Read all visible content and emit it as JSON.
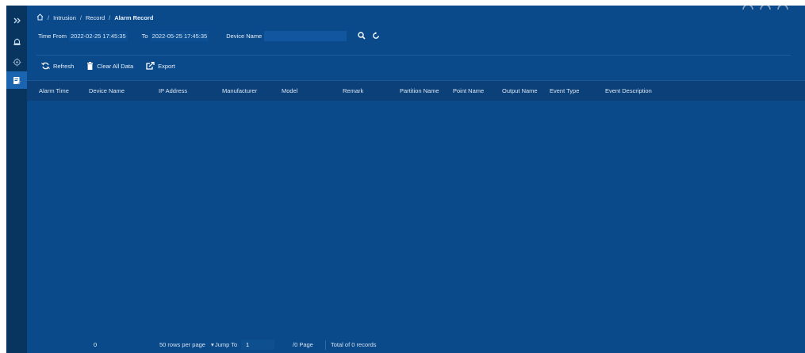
{
  "colors": {
    "background": "#0a4a8a",
    "sidebar": "#08355f",
    "sidebar_active": "#1b64b0",
    "table_header": "#0b4078",
    "text": "#ffffff"
  },
  "sidebar": {
    "items": [
      {
        "name": "expand",
        "icon": "double-chevron-right-icon",
        "active": false
      },
      {
        "name": "intrusion",
        "icon": "alarm-bell-icon",
        "active": false
      },
      {
        "name": "settings",
        "icon": "gear-icon",
        "active": false
      },
      {
        "name": "record",
        "icon": "record-edit-icon",
        "active": true
      }
    ]
  },
  "breadcrumb": {
    "home_icon": "home-icon",
    "separator": "/",
    "items": [
      "Intrusion",
      "Record",
      "Alarm Record"
    ]
  },
  "filter": {
    "time_from_label": "Time From",
    "time_from_value": "2022-02-25 17:45:35",
    "to_label": "To",
    "to_value": "2022-05-25 17:45:35",
    "device_name_label": "Device Name",
    "device_name_value": "",
    "search_icon": "search-icon",
    "reset_icon": "reset-icon"
  },
  "toolbar": {
    "refresh_label": "Refresh",
    "clear_label": "Clear All Data",
    "export_label": "Export"
  },
  "table": {
    "columns": [
      "Alarm Time",
      "Device Name",
      "IP Address",
      "Manufacturer",
      "Model",
      "Remark",
      "Partition Name",
      "Point Name",
      "Output Name",
      "Event Type",
      "Event Description"
    ],
    "rows": []
  },
  "pagination": {
    "current_page": "0",
    "page_size_label": "50 rows per page",
    "jump_to_label": "Jump To",
    "jump_to_value": "1",
    "per_page_label": "/0 Page",
    "total_label": "Total of 0 records"
  }
}
